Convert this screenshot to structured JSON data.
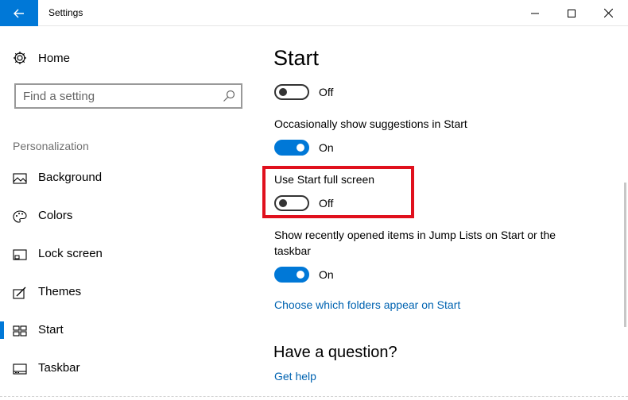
{
  "window": {
    "title": "Settings",
    "back_icon": "arrow-left-icon",
    "minimize_icon": "minimize-icon",
    "maximize_icon": "maximize-icon",
    "close_icon": "close-icon",
    "accent_color": "#0078d7"
  },
  "sidebar": {
    "home_label": "Home",
    "search_placeholder": "Find a setting",
    "section_label": "Personalization",
    "items": [
      {
        "label": "Background",
        "icon": "picture-icon",
        "active": false
      },
      {
        "label": "Colors",
        "icon": "palette-icon",
        "active": false
      },
      {
        "label": "Lock screen",
        "icon": "lock-screen-icon",
        "active": false
      },
      {
        "label": "Themes",
        "icon": "themes-icon",
        "active": false
      },
      {
        "label": "Start",
        "icon": "start-icon",
        "active": true
      },
      {
        "label": "Taskbar",
        "icon": "taskbar-icon",
        "active": false
      }
    ]
  },
  "main": {
    "title": "Start",
    "settings": [
      {
        "label": "",
        "state": "Off",
        "on": false
      },
      {
        "label": "Occasionally show suggestions in Start",
        "state": "On",
        "on": true
      },
      {
        "label": "Use Start full screen",
        "state": "Off",
        "on": false,
        "highlighted": true
      },
      {
        "label_line1": "Show recently opened items in Jump Lists on Start or the",
        "label_line2": "taskbar",
        "state": "On",
        "on": true
      }
    ],
    "folders_link": "Choose which folders appear on Start",
    "help_title": "Have a question?",
    "help_link": "Get help",
    "highlight_color": "#e0101d"
  }
}
